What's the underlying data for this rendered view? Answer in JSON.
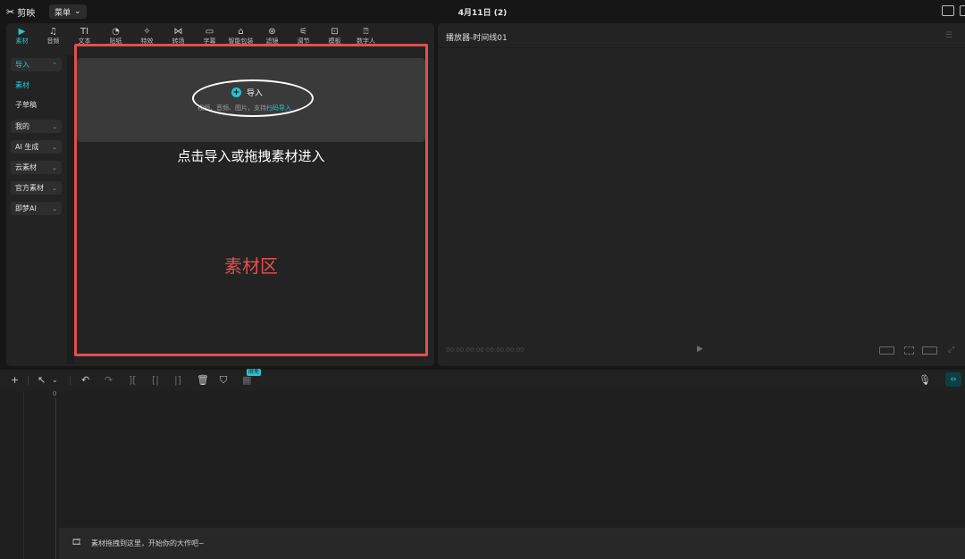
{
  "app": {
    "name": "剪映",
    "menu_label": "菜单",
    "window_title": "4月11日 (2)"
  },
  "toolbar": {
    "tabs": [
      {
        "icon": "▶",
        "label": "素材",
        "active": true
      },
      {
        "icon": "♫",
        "label": "音频"
      },
      {
        "icon": "TI",
        "label": "文本"
      },
      {
        "icon": "◔",
        "label": "贴纸"
      },
      {
        "icon": "✧",
        "label": "特效"
      },
      {
        "icon": "⋈",
        "label": "转场"
      },
      {
        "icon": "▭",
        "label": "字幕"
      },
      {
        "icon": "⌂",
        "label": "智能包装"
      },
      {
        "icon": "⊛",
        "label": "滤镜"
      },
      {
        "icon": "⚟",
        "label": "调节"
      },
      {
        "icon": "⊡",
        "label": "模板"
      },
      {
        "icon": "⍰",
        "label": "数字人"
      }
    ]
  },
  "sidebar": {
    "items": [
      {
        "label": "导入",
        "chevron": "⌃",
        "active": true
      },
      {
        "label": "素材",
        "active": true,
        "plain": true
      },
      {
        "label": "子草稿",
        "plain": true
      },
      {
        "label": "我的",
        "chevron": "⌄"
      },
      {
        "label": "AI 生成",
        "chevron": "⌄"
      },
      {
        "label": "云素材",
        "chevron": "⌄"
      },
      {
        "label": "官方素材",
        "chevron": "⌄"
      },
      {
        "label": "即梦AI",
        "chevron": "⌄"
      }
    ]
  },
  "import_area": {
    "button_label": "导入",
    "hint_prefix": "视频、音频、图片，支持",
    "hint_link": "扫码导入"
  },
  "annotations": {
    "drop_hint": "点击导入或拖拽素材进入",
    "zone_label": "素材区"
  },
  "player": {
    "title": "播放器-时间线01",
    "timecode": "00:00:00:00  00:00:00:00"
  },
  "timeline": {
    "zero_label": "0",
    "free_badge": "限免",
    "drop_text": "素材拖拽到这里，开始你的大作吧~"
  },
  "colors": {
    "accent": "#22c7d5",
    "annotation_red": "#e0504e"
  }
}
